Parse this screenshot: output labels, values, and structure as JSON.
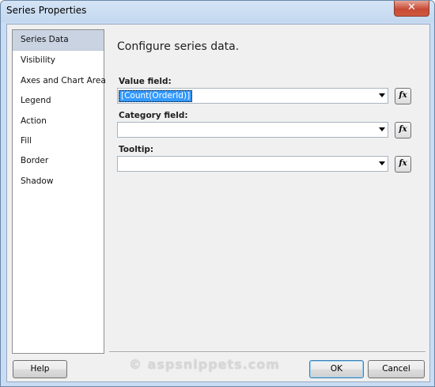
{
  "window": {
    "title": "Series Properties",
    "close_glyph": "✕"
  },
  "sidebar": {
    "items": [
      {
        "label": "Series Data",
        "selected": true
      },
      {
        "label": "Visibility"
      },
      {
        "label": "Axes and Chart Area"
      },
      {
        "label": "Legend"
      },
      {
        "label": "Action"
      },
      {
        "label": "Fill"
      },
      {
        "label": "Border"
      },
      {
        "label": "Shadow"
      }
    ]
  },
  "main": {
    "heading": "Configure series data.",
    "fields": [
      {
        "label": "Value field:",
        "value": "[Count(OrderId)]"
      },
      {
        "label": "Category field:",
        "value": ""
      },
      {
        "label": "Tooltip:",
        "value": ""
      }
    ],
    "fx_label": "fx"
  },
  "footer": {
    "help_label": "Help",
    "ok_label": "OK",
    "cancel_label": "Cancel",
    "watermark": "© aspsnippets.com"
  },
  "colors": {
    "selection_highlight": "#3399ff",
    "nav_selected": "#c9d3e2"
  }
}
